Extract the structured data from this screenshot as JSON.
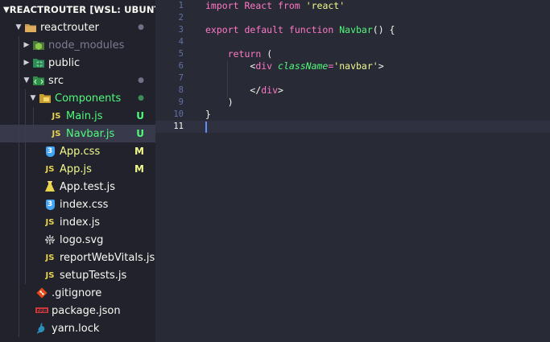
{
  "explorer": {
    "title": "REACTROUTER [WSL: UBUNTU]",
    "items": [
      {
        "label": "reactrouter",
        "badge": "●",
        "color": "#f8f8f2",
        "badge_color": "#6f7186",
        "icon": "folder-icon"
      },
      {
        "label": "node_modules",
        "badge": "",
        "color": "#7b7d92",
        "badge_color": "",
        "icon": "node-folder-icon"
      },
      {
        "label": "public",
        "badge": "",
        "color": "#f8f8f2",
        "badge_color": "",
        "icon": "public-folder-icon"
      },
      {
        "label": "src",
        "badge": "●",
        "color": "#f8f8f2",
        "badge_color": "#6f7186",
        "icon": "src-folder-icon"
      },
      {
        "label": "Components",
        "badge": "●",
        "color": "#50fa7b",
        "badge_color": "#3a8d56",
        "icon": "components-folder-icon"
      },
      {
        "label": "Main.js",
        "badge": "U",
        "color": "#50fa7b",
        "badge_color": "#50fa7b",
        "icon": "js-icon"
      },
      {
        "label": "Navbar.js",
        "badge": "U",
        "color": "#50fa7b",
        "badge_color": "#50fa7b",
        "icon": "js-icon"
      },
      {
        "label": "App.css",
        "badge": "M",
        "color": "#f1fa8c",
        "badge_color": "#f1fa8c",
        "icon": "css-icon"
      },
      {
        "label": "App.js",
        "badge": "M",
        "color": "#f1fa8c",
        "badge_color": "#f1fa8c",
        "icon": "js-icon"
      },
      {
        "label": "App.test.js",
        "badge": "",
        "color": "#f8f8f2",
        "badge_color": "",
        "icon": "test-js-icon"
      },
      {
        "label": "index.css",
        "badge": "",
        "color": "#f8f8f2",
        "badge_color": "",
        "icon": "css-icon"
      },
      {
        "label": "index.js",
        "badge": "",
        "color": "#f8f8f2",
        "badge_color": "",
        "icon": "js-icon"
      },
      {
        "label": "logo.svg",
        "badge": "",
        "color": "#f8f8f2",
        "badge_color": "",
        "icon": "svg-icon"
      },
      {
        "label": "reportWebVitals.js",
        "badge": "",
        "color": "#f8f8f2",
        "badge_color": "",
        "icon": "js-icon"
      },
      {
        "label": "setupTests.js",
        "badge": "",
        "color": "#f8f8f2",
        "badge_color": "",
        "icon": "js-icon"
      },
      {
        "label": ".gitignore",
        "badge": "",
        "color": "#f8f8f2",
        "badge_color": "",
        "icon": "git-icon"
      },
      {
        "label": "package.json",
        "badge": "",
        "color": "#f8f8f2",
        "badge_color": "",
        "icon": "npm-icon"
      },
      {
        "label": "yarn.lock",
        "badge": "",
        "color": "#f8f8f2",
        "badge_color": "",
        "icon": "yarn-icon"
      }
    ]
  },
  "editor": {
    "line_numbers": [
      "1",
      "2",
      "3",
      "4",
      "5",
      "6",
      "7",
      "8",
      "9",
      "10",
      "11"
    ],
    "active_line": "11",
    "code": {
      "l1": {
        "import": "import",
        "react_name": "React",
        "from": "from",
        "module": "'react'"
      },
      "l3": {
        "export": "export",
        "default": "default",
        "function": "function",
        "name": "Navbar",
        "parens": "() {"
      },
      "l5": {
        "return": "return",
        "paren": "("
      },
      "l6": {
        "open": "<",
        "tag": "div",
        "attr": "className",
        "eq": "=",
        "value": "'navbar'",
        "close": ">"
      },
      "l8": {
        "close_tag": "</",
        "tag": "div",
        "end": ">"
      },
      "l9": {
        "paren": ")"
      },
      "l10": {
        "brace": "}"
      }
    }
  }
}
